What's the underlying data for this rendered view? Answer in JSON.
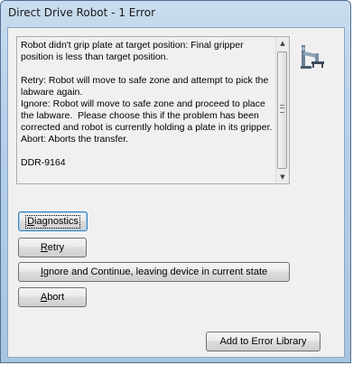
{
  "window": {
    "title": "Direct Drive Robot - 1 Error"
  },
  "message": {
    "text": "Robot didn't grip plate at target position: Final gripper position is less than target position.\n\nRetry: Robot will move to safe zone and attempt to pick the labware again.\nIgnore: Robot will move to safe zone and proceed to place the labware.  Please choose this if the problem has been corrected and robot is currently holding a plate in its gripper.\nAbort: Aborts the transfer.\n\nDDR-9164"
  },
  "icons": {
    "robot": "robot-arm-icon",
    "scroll_up": "chevron-up-icon",
    "scroll_down": "chevron-down-icon"
  },
  "buttons": {
    "diagnostics": {
      "mnemonic": "D",
      "rest": "iagnostics"
    },
    "retry": {
      "mnemonic": "R",
      "rest": "etry"
    },
    "ignore": {
      "mnemonic": "I",
      "rest": "gnore and Continue, leaving device in current state"
    },
    "abort": {
      "mnemonic": "A",
      "rest": "bort"
    },
    "add_to_library": "Add to Error Library"
  }
}
